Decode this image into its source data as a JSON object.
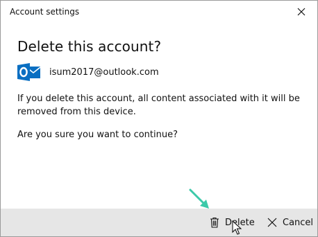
{
  "window": {
    "title": "Account settings"
  },
  "dialog": {
    "heading": "Delete this account?",
    "account_email": "isum2017@outlook.com",
    "account_icon": "outlook-icon",
    "message": "If you delete this account, all content associated with it will be removed from this device.",
    "confirm_question": "Are you sure you want to continue?"
  },
  "footer": {
    "delete_label": "Delete",
    "delete_icon": "trash-icon",
    "cancel_label": "Cancel",
    "cancel_icon": "close-icon"
  },
  "colors": {
    "outlook_blue": "#0a6fc2",
    "footer_bg": "#e6e6e6",
    "annotation_arrow": "#3cc9a9"
  }
}
